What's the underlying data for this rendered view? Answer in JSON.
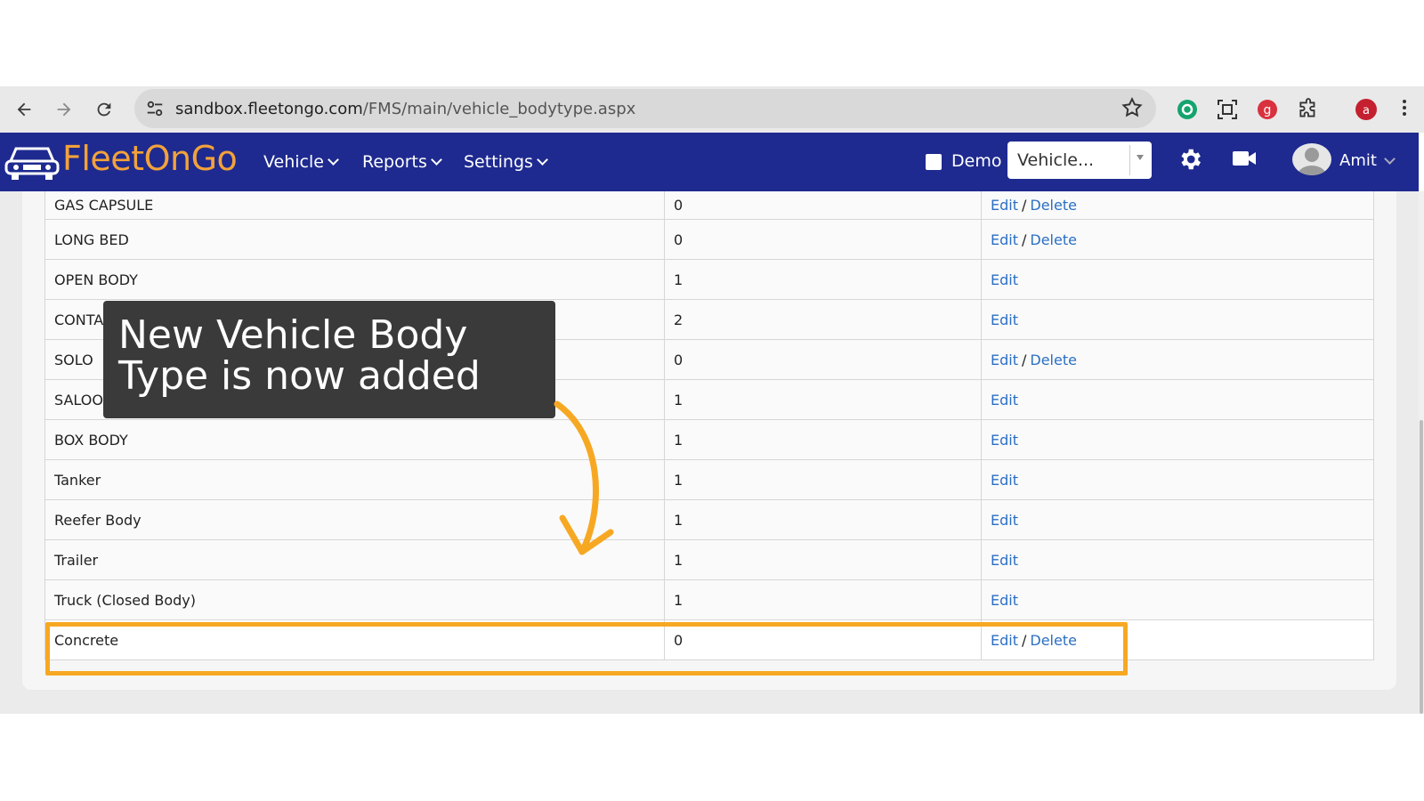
{
  "browser": {
    "url_host": "sandbox.fleetongo.com",
    "url_path": "/FMS/main/vehicle_bodytype.aspx",
    "profile_initial": "a"
  },
  "app": {
    "brand_fleet": "Fleet",
    "brand_on": "On",
    "brand_go": "Go",
    "menu": [
      {
        "label": "Vehicle"
      },
      {
        "label": "Reports"
      },
      {
        "label": "Settings"
      }
    ],
    "demo_label": "Demo",
    "vehicle_select_value": "Vehicle...",
    "user_name": "Amit"
  },
  "table": {
    "rows": [
      {
        "name": "GAS CAPSULE",
        "count": "0",
        "edit": "Edit",
        "delete": "Delete"
      },
      {
        "name": "LONG BED",
        "count": "0",
        "edit": "Edit",
        "delete": "Delete"
      },
      {
        "name": "OPEN BODY",
        "count": "1",
        "edit": "Edit",
        "delete": ""
      },
      {
        "name": "CONTA",
        "count": "2",
        "edit": "Edit",
        "delete": ""
      },
      {
        "name": "SOLO",
        "count": "0",
        "edit": "Edit",
        "delete": "Delete"
      },
      {
        "name": "SALOON",
        "count": "1",
        "edit": "Edit",
        "delete": ""
      },
      {
        "name": "BOX BODY",
        "count": "1",
        "edit": "Edit",
        "delete": ""
      },
      {
        "name": "Tanker",
        "count": "1",
        "edit": "Edit",
        "delete": ""
      },
      {
        "name": "Reefer Body",
        "count": "1",
        "edit": "Edit",
        "delete": ""
      },
      {
        "name": "Trailer",
        "count": "1",
        "edit": "Edit",
        "delete": ""
      },
      {
        "name": "Truck (Closed Body)",
        "count": "1",
        "edit": "Edit",
        "delete": ""
      },
      {
        "name": "Concrete",
        "count": "0",
        "edit": "Edit",
        "delete": "Delete"
      }
    ]
  },
  "callout": {
    "text": "New Vehicle Body\nType is now added"
  },
  "colors": {
    "header_bg": "#1e2a8f",
    "brand_orange": "#f3a23a",
    "highlight": "#f7a823",
    "link": "#2a6fc4"
  }
}
